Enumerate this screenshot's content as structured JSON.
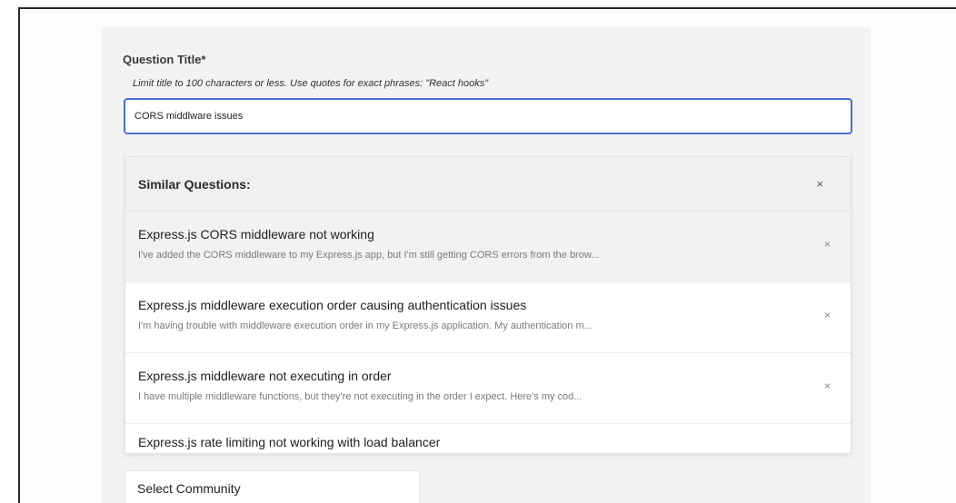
{
  "form": {
    "title_label": "Question Title*",
    "title_hint": "Limit title to 100 characters or less. Use quotes for exact phrases: \"React hooks\"",
    "title_value": "CORS middlware issues"
  },
  "similar": {
    "header": "Similar Questions:",
    "close_glyph": "×",
    "items": [
      {
        "title": "Express.js CORS middleware not working",
        "desc": "I've added the CORS middleware to my Express.js app, but I'm still getting CORS errors from the brow...",
        "dismiss": "×"
      },
      {
        "title": "Express.js middleware execution order causing authentication issues",
        "desc": "I'm having trouble with middleware execution order in my Express.js application. My authentication m...",
        "dismiss": "×"
      },
      {
        "title": "Express.js middleware not executing in order",
        "desc": "I have multiple middleware functions, but they're not executing in the order I expect. Here's my cod...",
        "dismiss": "×"
      },
      {
        "title": "Express.js rate limiting not working with load balancer"
      }
    ]
  },
  "community": {
    "label": "Select Community"
  }
}
